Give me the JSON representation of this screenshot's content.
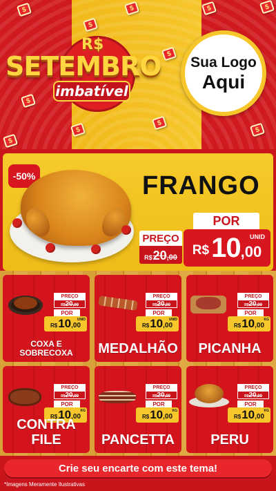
{
  "header": {
    "currency_mark": "R$",
    "title": "SETEMBRO",
    "subtitle": "imbatível",
    "logo_line1": "Sua Logo",
    "logo_line2": "Aqui",
    "confetti_symbol": "$"
  },
  "featured": {
    "discount": "-50%",
    "name": "FRANGO",
    "preco_label": "PREÇO",
    "old_currency": "R$",
    "old_price_int": "20",
    "old_price_cents": ",00",
    "por_label": "POR",
    "unit": "UNID",
    "new_currency": "R$",
    "new_price_int": "10",
    "new_price_cents": ",00"
  },
  "products": [
    {
      "name_line1": "COXA E",
      "name_line2": "SOBRECOXA",
      "preco_label": "PREÇO",
      "old_currency": "R$",
      "old_int": "20",
      "old_cents": ",00",
      "por_label": "POR",
      "currency": "R$",
      "price_int": "10",
      "price_cents": ",00",
      "unit": "UNID"
    },
    {
      "name_line1": "MEDALHÃO",
      "preco_label": "PREÇO",
      "old_currency": "R$",
      "old_int": "20",
      "old_cents": ",00",
      "por_label": "POR",
      "currency": "R$",
      "price_int": "10",
      "price_cents": ",00",
      "unit": "UNID"
    },
    {
      "name_line1": "PICANHA",
      "preco_label": "PREÇO",
      "old_currency": "R$",
      "old_int": "20",
      "old_cents": ",00",
      "por_label": "POR",
      "currency": "R$",
      "price_int": "10",
      "price_cents": ",00",
      "unit": "KG"
    },
    {
      "name_line1": "CONTRA FILE",
      "preco_label": "PREÇO",
      "old_currency": "R$",
      "old_int": "20",
      "old_cents": ",00",
      "por_label": "POR",
      "currency": "R$",
      "price_int": "10",
      "price_cents": ",00",
      "unit": "KG"
    },
    {
      "name_line1": "PANCETTA",
      "preco_label": "PREÇO",
      "old_currency": "R$",
      "old_int": "20",
      "old_cents": ",00",
      "por_label": "POR",
      "currency": "R$",
      "price_int": "10",
      "price_cents": ",00",
      "unit": "KG"
    },
    {
      "name_line1": "PERU",
      "preco_label": "PREÇO",
      "old_currency": "R$",
      "old_int": "20",
      "old_cents": ",00",
      "por_label": "POR",
      "currency": "R$",
      "price_int": "10",
      "price_cents": ",00",
      "unit": "KG"
    }
  ],
  "footer": {
    "cta": "Crie seu encarte com este tema!",
    "disclaimer": "*Imagens Meramente Ilustrativas"
  },
  "colors": {
    "red": "#c9141c",
    "yellow": "#f6c62a",
    "white": "#ffffff"
  }
}
